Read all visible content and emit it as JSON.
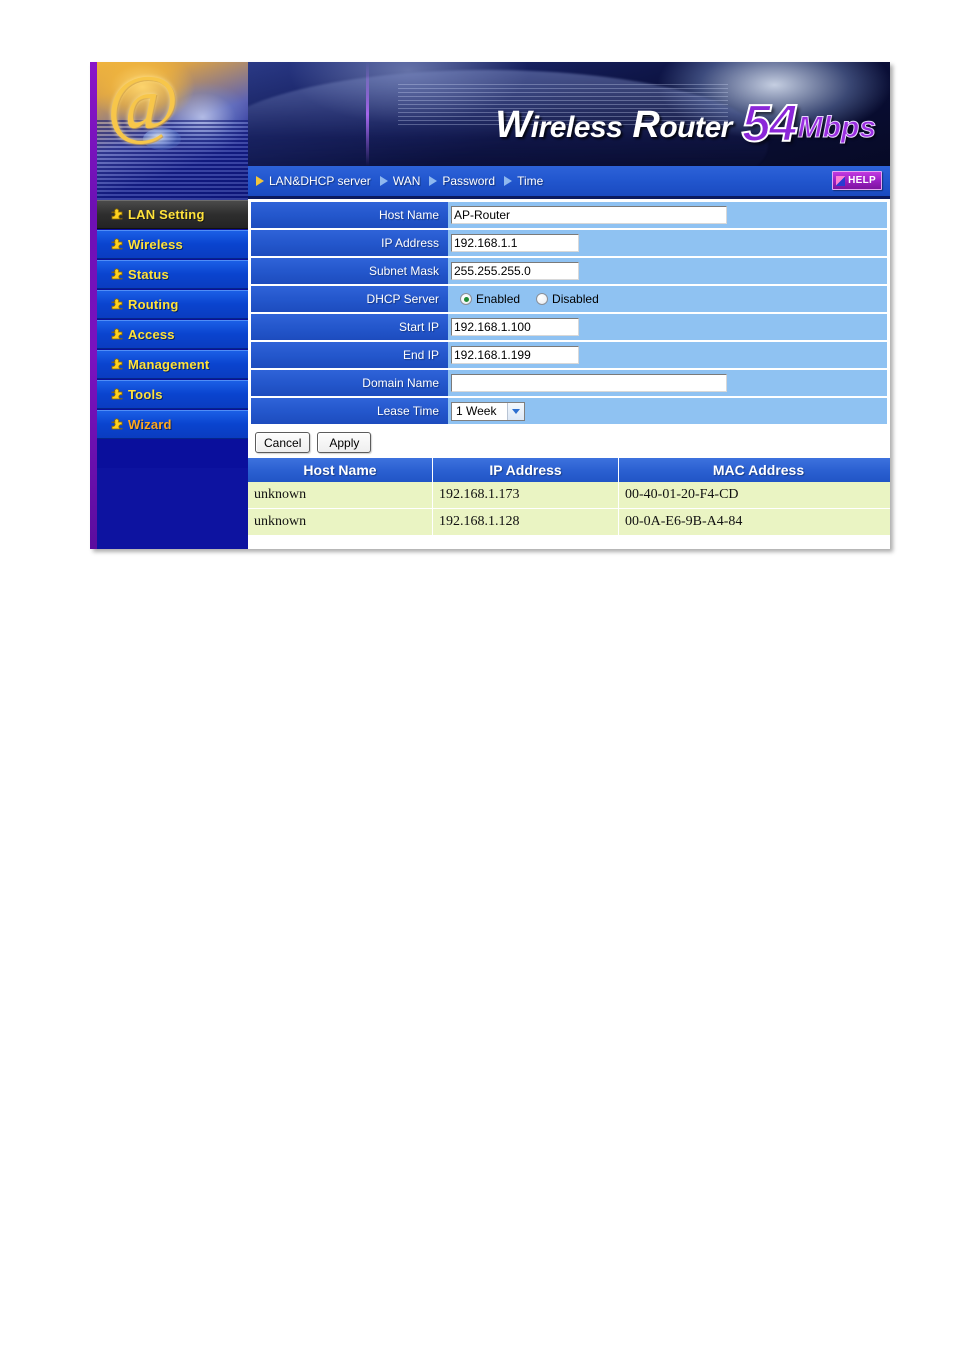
{
  "product": {
    "brand_glyph": "@",
    "banner_word1": "Wireless",
    "banner_word2": "Router",
    "banner_speed": "54",
    "banner_unit": "Mbps"
  },
  "sidebar": {
    "items": [
      {
        "label": "LAN Setting",
        "icon": "puzzle-icon",
        "active": true
      },
      {
        "label": "Wireless",
        "icon": "puzzle-icon",
        "active": false
      },
      {
        "label": "Status",
        "icon": "puzzle-icon",
        "active": false
      },
      {
        "label": "Routing",
        "icon": "puzzle-icon",
        "active": false
      },
      {
        "label": "Access",
        "icon": "puzzle-icon",
        "active": false
      },
      {
        "label": "Management",
        "icon": "puzzle-icon",
        "active": false
      },
      {
        "label": "Tools",
        "icon": "puzzle-icon",
        "active": false
      },
      {
        "label": "Wizard",
        "icon": "puzzle-icon",
        "active": false
      }
    ]
  },
  "navbar": {
    "items": [
      {
        "label": "LAN&DHCP server",
        "active": true
      },
      {
        "label": "WAN",
        "active": false
      },
      {
        "label": "Password",
        "active": false
      },
      {
        "label": "Time",
        "active": false
      }
    ],
    "help_label": "HELP"
  },
  "form": {
    "host_name": {
      "label": "Host Name",
      "value": "AP-Router",
      "placeholder": ""
    },
    "ip_address": {
      "label": "IP Address",
      "value": "192.168.1.1",
      "placeholder": ""
    },
    "subnet_mask": {
      "label": "Subnet Mask",
      "value": "255.255.255.0",
      "placeholder": ""
    },
    "dhcp_server": {
      "label": "DHCP Server",
      "enabled_label": "Enabled",
      "disabled_label": "Disabled",
      "selected": "Enabled"
    },
    "start_ip": {
      "label": "Start IP",
      "value": "192.168.1.100",
      "placeholder": ""
    },
    "end_ip": {
      "label": "End IP",
      "value": "192.168.1.199",
      "placeholder": ""
    },
    "domain_name": {
      "label": "Domain Name",
      "value": "",
      "placeholder": ""
    },
    "lease_time": {
      "label": "Lease Time",
      "value": "1 Week"
    }
  },
  "buttons": {
    "cancel": "Cancel",
    "apply": "Apply"
  },
  "client_table": {
    "headers": [
      "Host Name",
      "IP Address",
      "MAC Address"
    ],
    "rows": [
      [
        "unknown",
        "192.168.1.173",
        "00-40-01-20-F4-CD"
      ],
      [
        "unknown",
        "192.168.1.128",
        "00-0A-E6-9B-A4-84"
      ]
    ]
  },
  "colors": {
    "sidebar_bg": "#0a0f9c",
    "sidebar_item": "#0a44cf",
    "sidebar_active": "#2e2e2e",
    "label_blue": "#2356cb",
    "value_blue": "#8fc2f2",
    "table_row_green": "#eaf4c3",
    "menu_text_yellow": "#ffe23a",
    "wizard_orange": "#ffa81e",
    "help_purple": "#9b1fc4"
  }
}
